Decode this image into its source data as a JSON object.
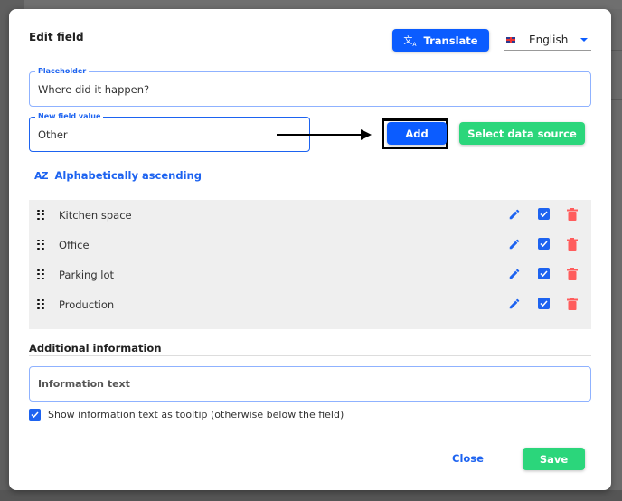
{
  "dialog": {
    "title": "Edit field",
    "translate_label": "Translate",
    "translate_icon": "translate-icon",
    "language": {
      "flag": "uk-flag-icon",
      "selected": "English"
    }
  },
  "placeholder_field": {
    "legend": "Placeholder",
    "value": "Where did it happen?"
  },
  "new_value_field": {
    "legend": "New field value",
    "value": "Other"
  },
  "actions": {
    "add_label": "Add",
    "select_source_label": "Select data source"
  },
  "sort": {
    "icon": "sort-az-icon",
    "icon_text": "AZ",
    "label": "Alphabetically ascending"
  },
  "options": [
    {
      "label": "Kitchen space",
      "checked": true
    },
    {
      "label": "Office",
      "checked": true
    },
    {
      "label": "Parking lot",
      "checked": true
    },
    {
      "label": "Production",
      "checked": true
    }
  ],
  "additional": {
    "heading": "Additional information",
    "info_placeholder": "Information text",
    "tooltip_label": "Show information text as tooltip (otherwise below the field)",
    "tooltip_checked": true
  },
  "footer": {
    "close_label": "Close",
    "save_label": "Save"
  },
  "colors": {
    "primary": "#0b5cff",
    "success": "#2bd67b",
    "danger": "#ff5c5c"
  }
}
